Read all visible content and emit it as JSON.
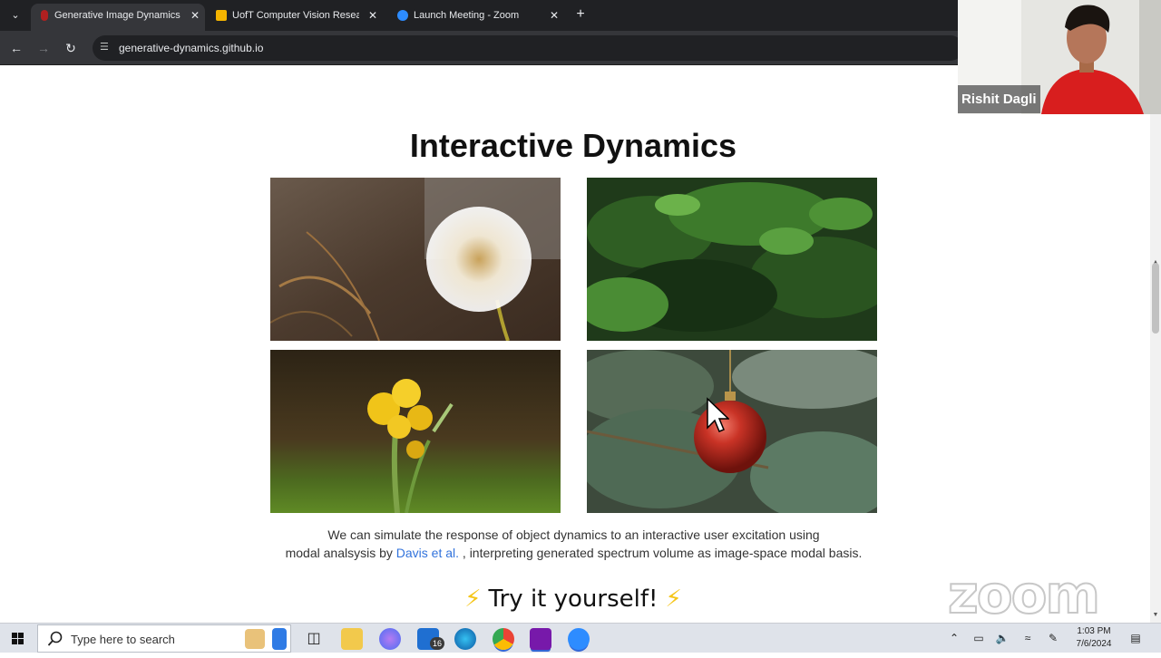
{
  "browser": {
    "tabs": [
      {
        "title": "Generative Image Dynamics",
        "active": true,
        "favicon_color": "#b02020"
      },
      {
        "title": "UofT Computer Vision Research",
        "active": false,
        "favicon_color": "#f4b400"
      },
      {
        "title": "Launch Meeting - Zoom",
        "active": false,
        "favicon_color": "#2d8cff"
      }
    ],
    "tab_close_glyph": "✕",
    "new_tab_glyph": "+",
    "url": "generative-dynamics.github.io"
  },
  "page": {
    "heading": "Interactive Dynamics",
    "images": [
      {
        "subject": "dandelion seed head"
      },
      {
        "subject": "green leafy branch"
      },
      {
        "subject": "yellow wildflower"
      },
      {
        "subject": "red christmas ornament on pine branch"
      }
    ],
    "caption_line1": "We can simulate the response of object dynamics to an interactive user excitation using",
    "caption_line2_before": "modal analsysis by",
    "caption_link": "Davis et al.",
    "caption_line2_after": ", interpreting generated spectrum volume as image-space modal basis.",
    "try_heading": "Try it yourself!",
    "bolt_glyph": "⚡"
  },
  "zoom": {
    "participant_name": "Rishit Dagli",
    "watermark": "zoom"
  },
  "taskbar": {
    "search_placeholder": "Type here to search",
    "mail_badge": "16",
    "time": "1:03 PM",
    "date": "7/6/2024"
  }
}
